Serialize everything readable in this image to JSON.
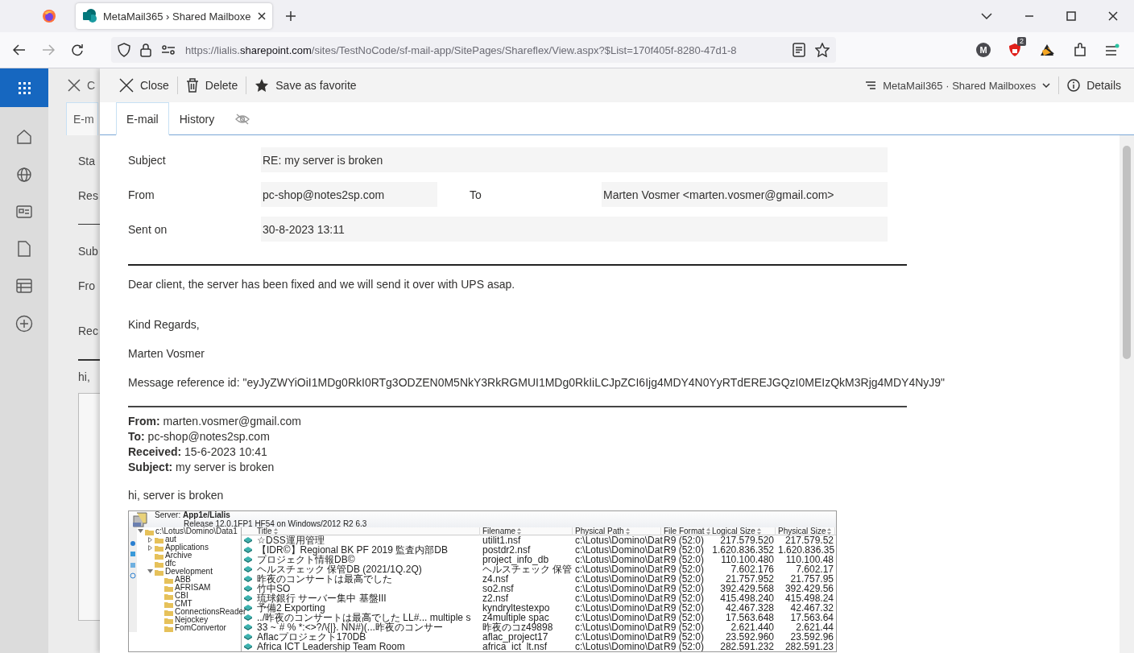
{
  "browser": {
    "tabs": [
      {
        "title": "MetaMail365 › Shared Mailboxe",
        "selected": true
      }
    ],
    "url": {
      "before_host": "https://lialis.",
      "host": "sharepoint.com",
      "after_host": "/sites/TestNoCode/sf-mail-app/SitePages/Shareflex/View.aspx?$List=170f405f-8280-47d1-8"
    },
    "account_letter": "M",
    "extension_badge": "2"
  },
  "background_page": {
    "close_label": "C",
    "tab_label": "E-m",
    "field_labels": [
      "Sta",
      "Res",
      "Sub",
      "Fro",
      "Rec"
    ],
    "body_text": "hi,"
  },
  "panel": {
    "toolbar": [
      {
        "kind": "close",
        "label": "Close"
      },
      {
        "kind": "delete",
        "label": "Delete"
      },
      {
        "kind": "favorite",
        "label": "Save as favorite"
      }
    ],
    "breadcrumb": "MetaMail365 · Shared Mailboxes",
    "details": "Details",
    "tabs": [
      {
        "kind": "text",
        "label": "E-mail",
        "selected": true
      },
      {
        "kind": "text",
        "label": "History",
        "selected": false
      },
      {
        "kind": "hidden",
        "selected": false
      }
    ],
    "fields": [
      [
        {
          "label": "Subject",
          "value": "RE: my server is broken"
        }
      ],
      [
        {
          "label": "From",
          "value": "pc-shop@notes2sp.com"
        },
        {
          "label": "To",
          "value": "Marten Vosmer <marten.vosmer@gmail.com>"
        }
      ],
      [
        {
          "label": "Sent on",
          "value": "30-8-2023 13:11"
        }
      ]
    ],
    "body": [
      "Dear client, the server has been fixed and we will send it over with UPS asap.",
      "Kind Regards,",
      "Marten Vosmer",
      "Message reference id: \"eyJyZWYiOiI1MDg0RkI0RTg3ODZEN0M5NkY3RkRGMUI1MDg0RkIiLCJpZCI6Ijg4MDY4N0YyRTdEREJGQzI0MEIzQkM3Rjg4MDY4NyJ9\""
    ],
    "quoted_header": [
      "**From:** marten.vosmer@gmail.com",
      "**To:** pc-shop@notes2sp.com",
      "**Received:** 15-6-2023 10:41",
      "**Subject:** my server is broken"
    ],
    "quoted_body": "hi, server is broken",
    "attachment_screenshot": {
      "server_label": "Server:",
      "server_name": "App1e/Lialis",
      "release": "Release 12.0.1FP1 HF54 on Windows/2012 R2 6.3",
      "tree": [
        {
          "label": "c:\\Lotus\\Domino\\Data1",
          "expanded": true,
          "children": [
            {
              "label": "aut",
              "expanded": false
            },
            {
              "label": "Applications",
              "expanded": false
            },
            {
              "label": "Archive"
            },
            {
              "label": "dfc"
            },
            {
              "label": "Development",
              "expanded": true,
              "children": [
                {
                  "label": "ABB"
                },
                {
                  "label": "AFRISAM"
                },
                {
                  "label": "CBI"
                },
                {
                  "label": "CMT"
                },
                {
                  "label": "ConnectionsReader"
                },
                {
                  "label": "Nejockey"
                },
                {
                  "label": "FomConvertor"
                }
              ]
            }
          ]
        }
      ],
      "columns": [
        "Title",
        "Filename",
        "Physical Path",
        "File Format",
        "Logical Size",
        "Physical Size"
      ],
      "rows": [
        [
          "☆DSS運用管理",
          "utilit1.nsf",
          "c:\\Lotus\\Domino\\Dat",
          "R9 (52:0)",
          "217.579.520",
          "217.579.52"
        ],
        [
          "【IDR©】Regional BK PF 2019 監査内部DB",
          "postdr2.nsf",
          "c:\\Lotus\\Domino\\Dat",
          "R9 (52:0)",
          "1.620.836.352",
          "1.620.836.35"
        ],
        [
          "プロジェクト情報DB©",
          "project_info_db",
          "c:\\Lotus\\Domino\\Dat",
          "R9 (52:0)",
          "110.100.480",
          "110.100.48"
        ],
        [
          "ヘルスチェック 保管DB (2021/1Q.2Q)",
          "ヘルスチェック 保管",
          "c:\\Lotus\\Domino\\Dat",
          "R9 (52:0)",
          "7.602.176",
          "7.602.17"
        ],
        [
          "昨夜のコンサートは最高でした",
          "z4.nsf",
          "c:\\Lotus\\Domino\\Dat",
          "R9 (52:0)",
          "21.757.952",
          "21.757.95"
        ],
        [
          "竹中SO",
          "so2.nsf",
          "c:\\Lotus\\Domino\\Dat",
          "R9 (52:0)",
          "392.429.568",
          "392.429.56"
        ],
        [
          "琉球銀行 サーバー集中 基盤III",
          "z2.nsf",
          "c:\\Lotus\\Domino\\Dat",
          "R9 (52:0)",
          "415.498.240",
          "415.498.24"
        ],
        [
          "予備2 Exporting",
          "kyndryltestexpo",
          "c:\\Lotus\\Domino\\Dat",
          "R9 (52:0)",
          "42.467.328",
          "42.467.32"
        ],
        [
          "../昨夜のコンサートは最高でした LL#... multiple s",
          "z4multiple spac",
          "c:\\Lotus\\Domino\\Dat",
          "R9 (52:0)",
          "17.563.648",
          "17.563.64"
        ],
        [
          "33 ~`# % *:<>?/\\{|}. NN#)(...昨夜のコンサー",
          "昨夜のコz49898",
          "c:\\Lotus\\Domino\\Dat",
          "R9 (52:0)",
          "2.621.440",
          "2.621.44"
        ],
        [
          "Aflacプロジェクト170DB",
          "aflac_project17",
          "c:\\Lotus\\Domino\\Dat",
          "R9 (52:0)",
          "23.592.960",
          "23.592.96"
        ],
        [
          "Africa ICT Leadership Team Room",
          "africa_ict_lt.nsf",
          "c:\\Lotus\\Domino\\Dat",
          "R9 (52:0)",
          "282.591.232",
          "282.591.23"
        ]
      ]
    }
  }
}
